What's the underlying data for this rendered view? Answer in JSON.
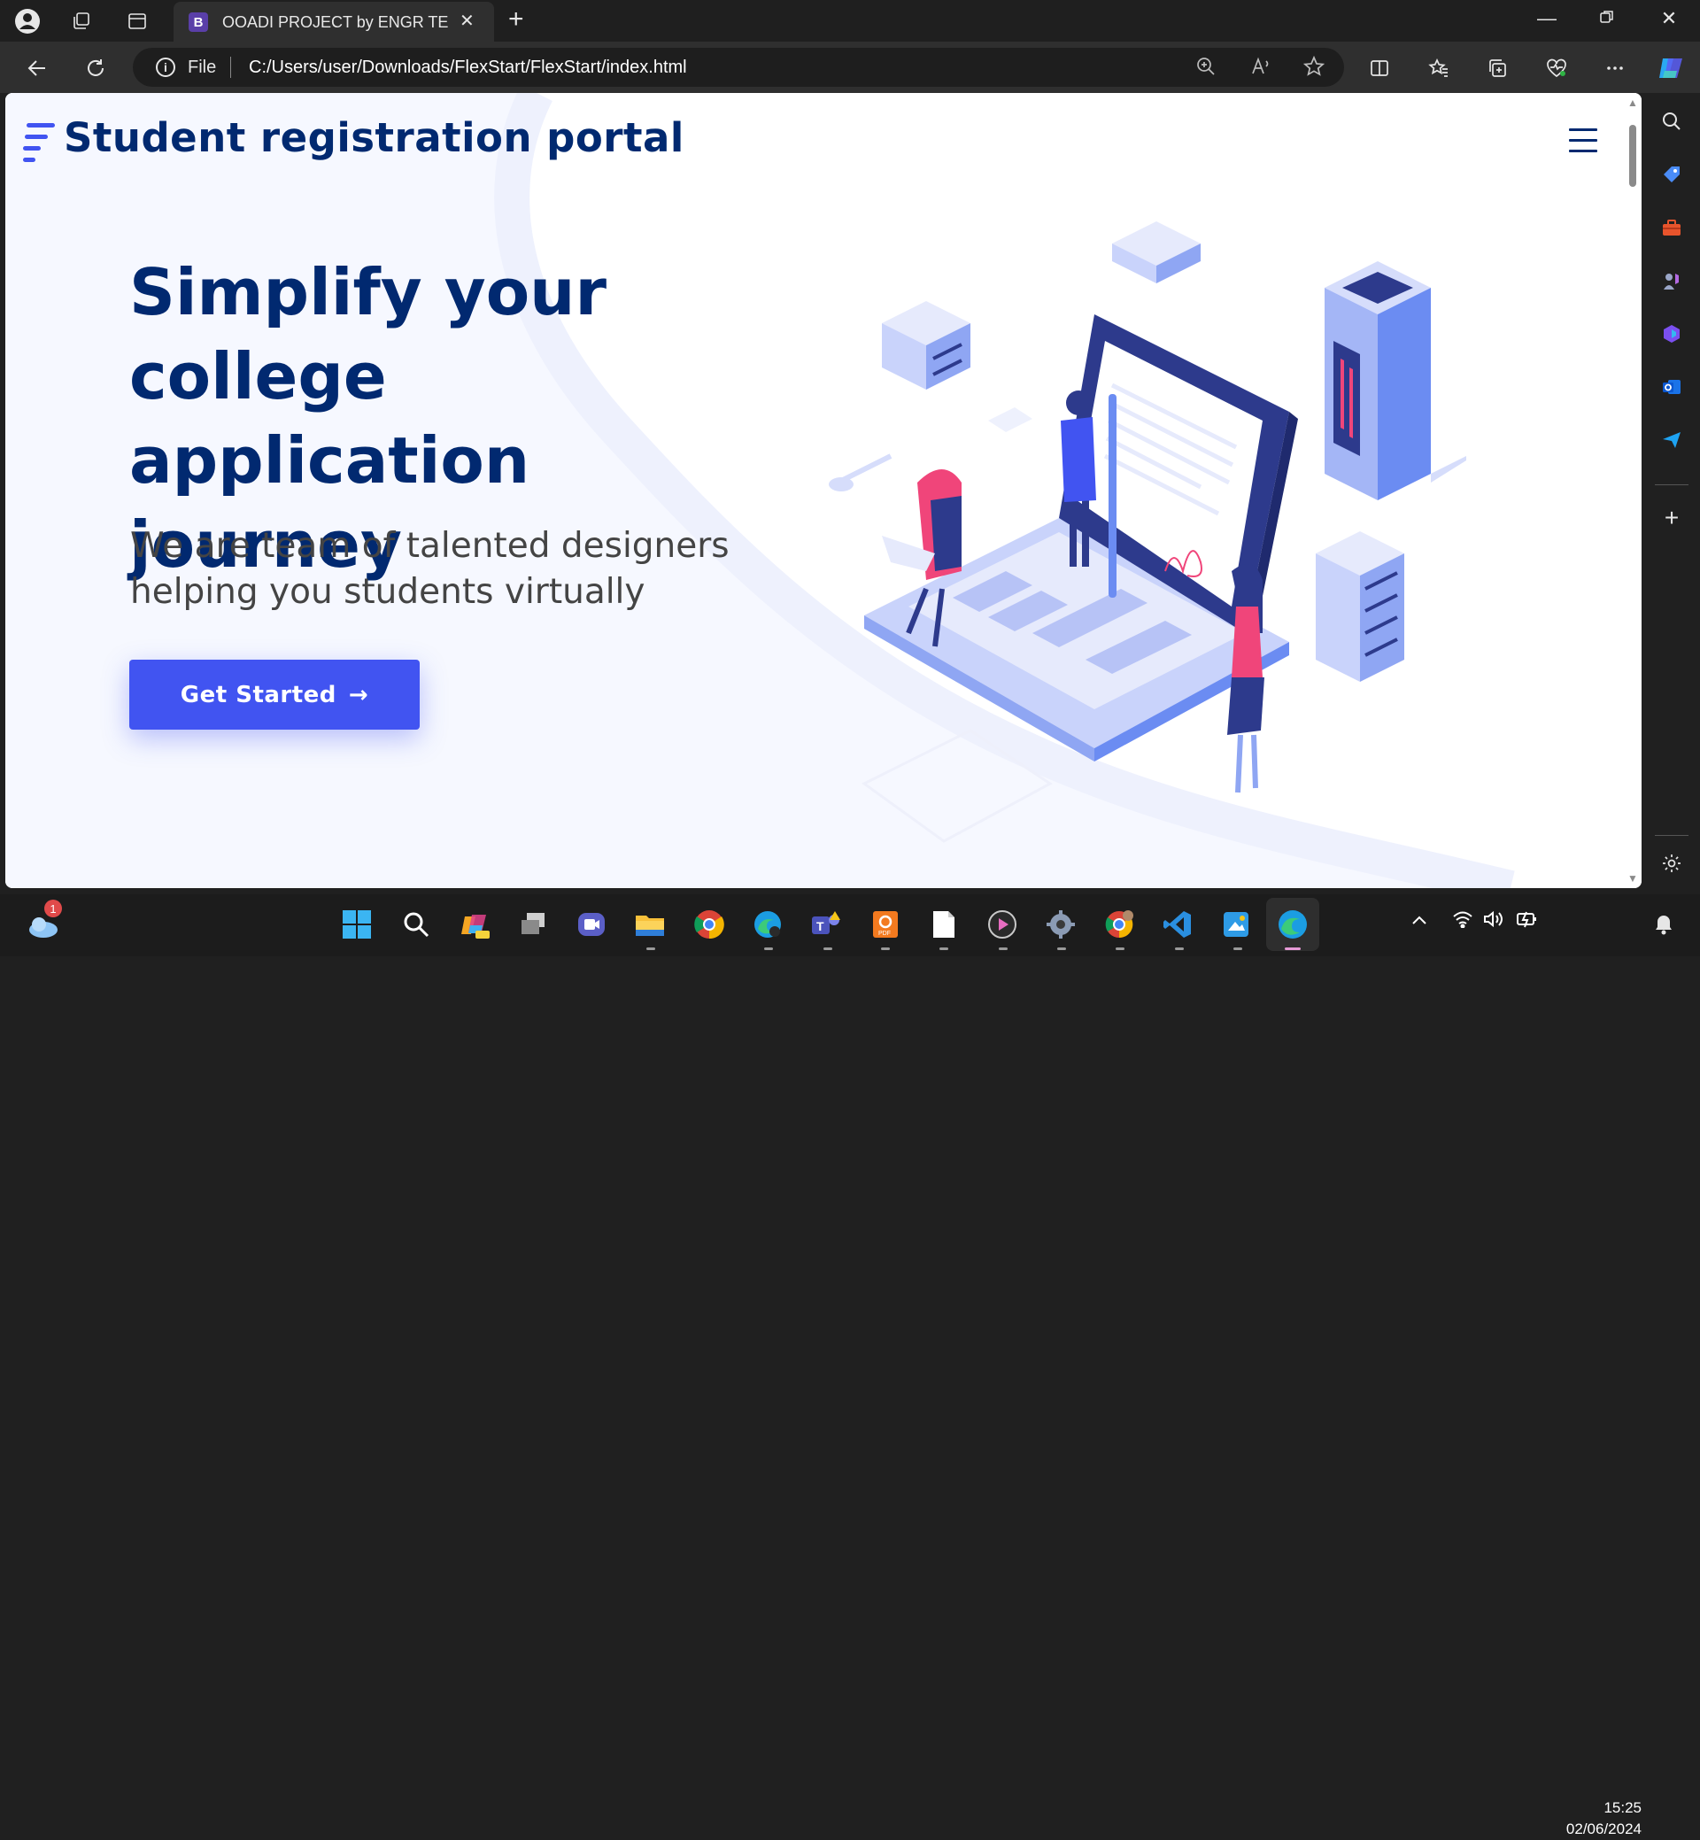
{
  "browser": {
    "tab_title": "OOADI PROJECT by ENGR TEKO",
    "tab_favicon_letter": "B",
    "address_prefix": "File",
    "url": "C:/Users/user/Downloads/FlexStart/FlexStart/index.html"
  },
  "page": {
    "site_title": "Student registration portal",
    "hero_title": "Simplify your college application journey",
    "hero_subtitle": "We are team of talented designers helping you students virtually",
    "cta_label": "Get Started",
    "cta_arrow": "→"
  },
  "taskbar": {
    "weather_badge": "1",
    "time": "15:25",
    "date": "02/06/2024"
  },
  "colors": {
    "brand_dark": "#012970",
    "brand_primary": "#4154f1",
    "hero_bg": "#f5f7ff",
    "illustration_blue": "#6b8cf2",
    "illustration_navy": "#2d3a8c",
    "illustration_pink": "#f0457a"
  },
  "icons": {
    "profile": "profile-icon",
    "tab_actions": "tab-actions-icon",
    "tab_strip": "vertical-tabs-icon",
    "back": "back-arrow-icon",
    "refresh": "refresh-icon",
    "info": "info-icon",
    "zoom": "zoom-icon",
    "read_aloud": "read-aloud-icon",
    "favorite": "star-icon",
    "split": "split-screen-icon",
    "favorites": "favorites-icon",
    "collections": "collections-icon",
    "health": "browser-essentials-icon",
    "more": "more-icon",
    "copilot": "copilot-icon"
  }
}
